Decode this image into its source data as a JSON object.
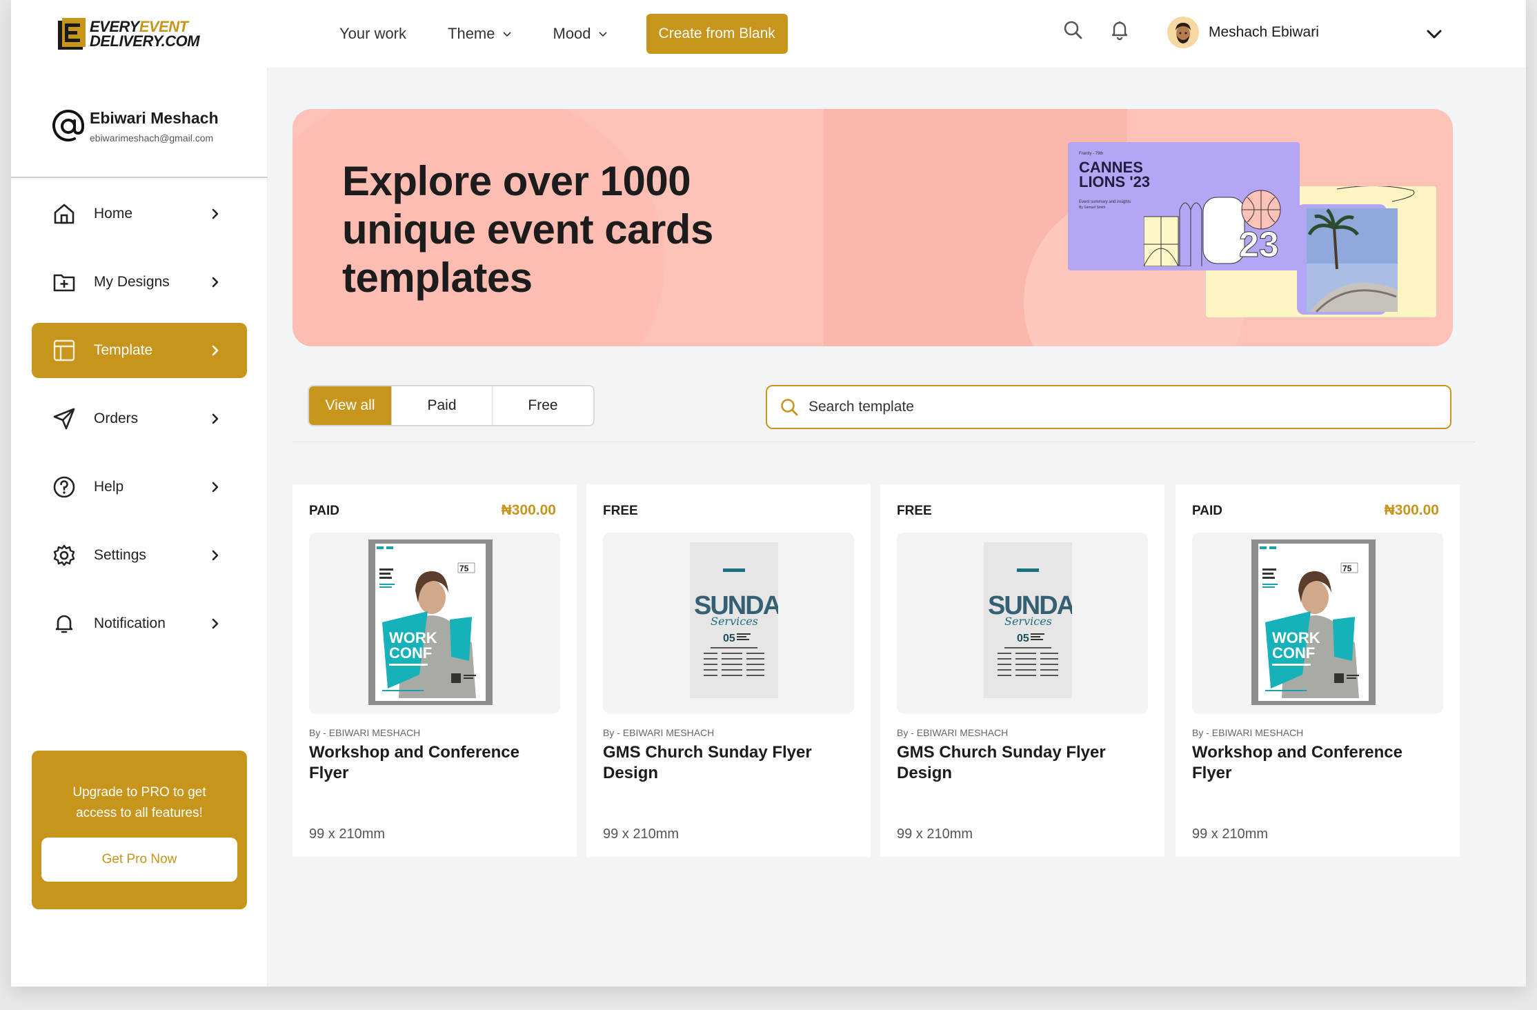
{
  "brand": {
    "logo_line1_a": "EVERY",
    "logo_line1_b": "EVENT",
    "logo_line2": "DELIVERY.COM"
  },
  "topnav": {
    "items": [
      {
        "label": "Your work",
        "dropdown": false
      },
      {
        "label": "Theme",
        "dropdown": true
      },
      {
        "label": "Mood",
        "dropdown": true
      }
    ],
    "create_label": "Create from Blank",
    "user_name": "Meshach Ebiwari"
  },
  "profile": {
    "name": "Ebiwari Meshach",
    "email": "ebiwarimeshach@gmail.com"
  },
  "sidebar": {
    "items": [
      {
        "label": "Home",
        "icon": "home-icon"
      },
      {
        "label": "My Designs",
        "icon": "folder-plus-icon"
      },
      {
        "label": "Template",
        "icon": "layout-icon"
      },
      {
        "label": "Orders",
        "icon": "send-icon"
      },
      {
        "label": "Help",
        "icon": "help-icon"
      },
      {
        "label": "Settings",
        "icon": "gear-icon"
      },
      {
        "label": "Notification",
        "icon": "bell-icon"
      }
    ],
    "active": "Template",
    "pro_text": "Upgrade to PRO to get access to all features!",
    "pro_button": "Get Pro Now"
  },
  "banner": {
    "title": "Explore over 1000 unique event cards templates",
    "card_small": "Frantly - 79th",
    "card_title_1": "CANNES",
    "card_title_2": "LIONS '23",
    "card_sub": "Event summary and insights",
    "card_sub2": "By Samuel Smith"
  },
  "filters": {
    "options": [
      "View all",
      "Paid",
      "Free"
    ],
    "active": "View all",
    "search_placeholder": "Search template"
  },
  "templates": [
    {
      "type": "PAID",
      "price": "₦300.00",
      "byline": "By - EBIWARI MESHACH",
      "title": "Workshop and Conference Flyer",
      "size": "99 x 210mm",
      "poster": "work-conf"
    },
    {
      "type": "FREE",
      "price": "",
      "byline": "By - EBIWARI MESHACH",
      "title": "GMS Church Sunday Flyer Design",
      "size": "99 x 210mm",
      "poster": "sunday"
    },
    {
      "type": "FREE",
      "price": "",
      "byline": "By - EBIWARI MESHACH",
      "title": "GMS Church Sunday Flyer Design",
      "size": "99 x 210mm",
      "poster": "sunday"
    },
    {
      "type": "PAID",
      "price": "₦300.00",
      "byline": "By - EBIWARI MESHACH",
      "title": "Workshop and Conference Flyer",
      "size": "99 x 210mm",
      "poster": "work-conf"
    }
  ],
  "colors": {
    "accent": "#c8951c",
    "banner": "#fcc2b8",
    "lilac": "#b4a6f5"
  }
}
